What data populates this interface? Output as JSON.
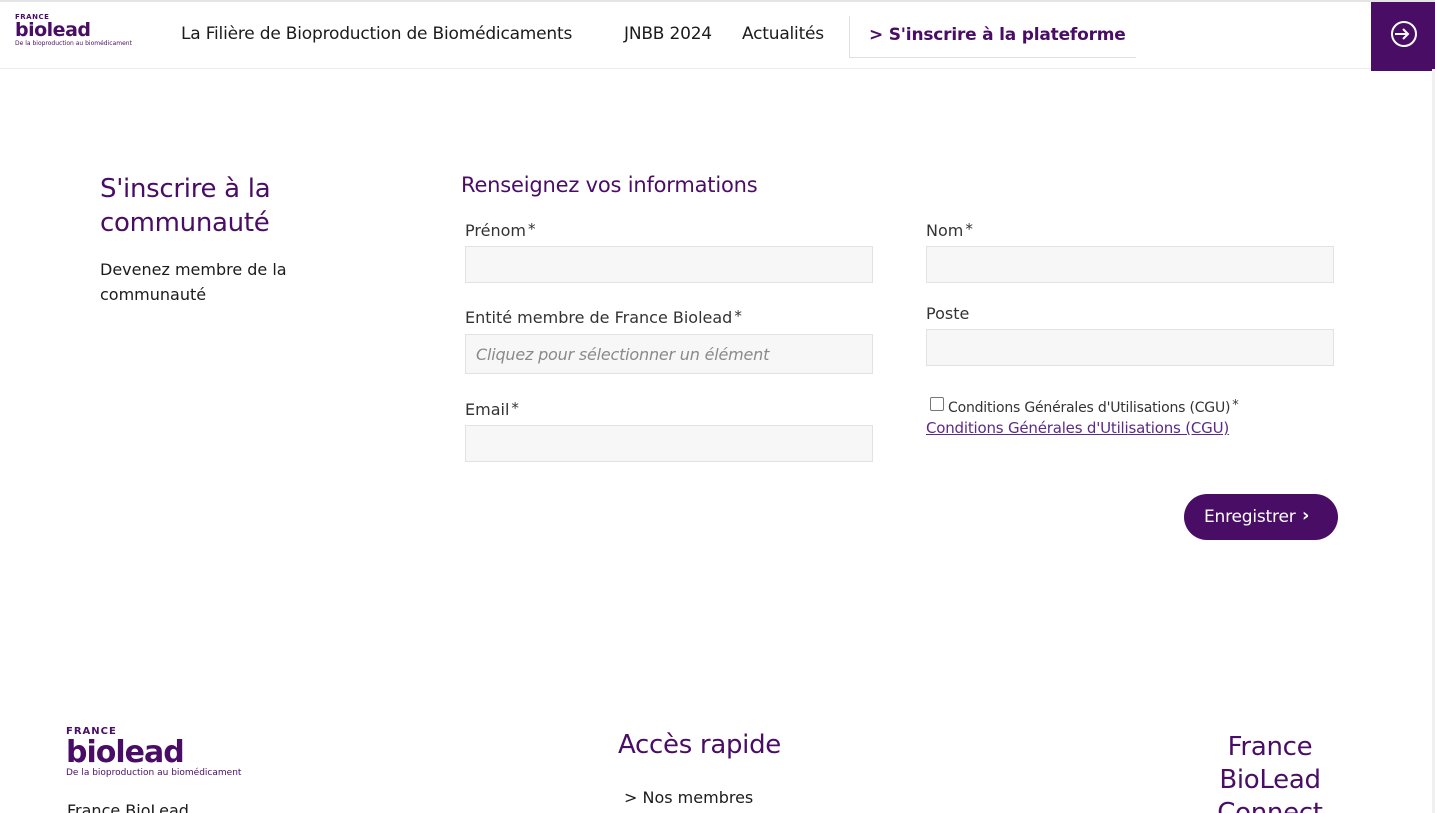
{
  "header": {
    "logo": {
      "france": "FRANCE",
      "name": "biolead",
      "tagline": "De la bioproduction au biomédicament"
    },
    "nav": [
      {
        "label": "La Filière de Bioproduction de Biomédicaments"
      },
      {
        "label": "JNBB 2024"
      },
      {
        "label": "Actualités"
      }
    ],
    "cta": "> S'inscrire à la plateforme",
    "login_icon": "login-arrow-icon"
  },
  "intro": {
    "title": "S'inscrire à la communauté",
    "text": "Devenez membre de la communauté"
  },
  "form": {
    "title": "Renseignez vos informations",
    "required_mark": "*",
    "fields": {
      "prenom": {
        "label": "Prénom",
        "value": ""
      },
      "nom": {
        "label": "Nom",
        "value": ""
      },
      "entite": {
        "label": "Entité membre de France Biolead",
        "placeholder": "Cliquez pour sélectionner un élément"
      },
      "poste": {
        "label": "Poste",
        "value": ""
      },
      "email": {
        "label": "Email",
        "value": ""
      }
    },
    "cgu": {
      "checkbox_label": "Conditions Générales d'Utilisations (CGU)",
      "link": "Conditions Générales d'Utilisations (CGU)",
      "checked": false
    },
    "submit": {
      "label": "Enregistrer",
      "icon": "chevron-right-icon"
    }
  },
  "footer": {
    "logo": {
      "france": "FRANCE",
      "name": "biolead",
      "tagline": "De la bioproduction au biomédicament"
    },
    "org": "France BioLead",
    "quick_access_title": "Accès rapide",
    "quick_links": [
      "> Nos membres"
    ],
    "connect_title": "France BioLead Connect"
  },
  "colors": {
    "brand": "#4a0d66",
    "field_bg": "#f7f7f7",
    "link": "#5b2a86"
  }
}
